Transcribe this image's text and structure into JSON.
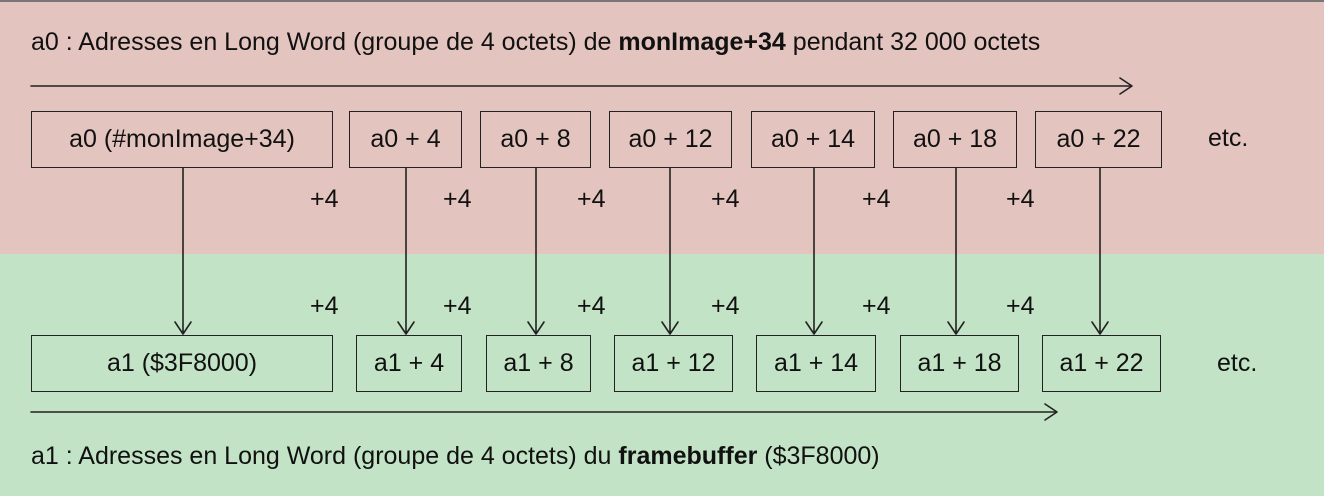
{
  "top": {
    "title_prefix": "a0 : Adresses en Long Word  (groupe de 4 octets)  de ",
    "title_bold": "monImage+34",
    "title_suffix": " pendant 32 000 octets",
    "boxes": [
      "a0 (#monImage+34)",
      "a0 + 4",
      "a0 + 8",
      "a0 + 12",
      "a0 + 14",
      "a0 + 18",
      "a0 + 22"
    ],
    "etc": "etc.",
    "increments": [
      "+4",
      "+4",
      "+4",
      "+4",
      "+4",
      "+4"
    ]
  },
  "bottom": {
    "increments": [
      "+4",
      "+4",
      "+4",
      "+4",
      "+4",
      "+4"
    ],
    "boxes": [
      "a1 ($3F8000)",
      "a1 + 4",
      "a1 + 8",
      "a1 + 12",
      "a1 + 14",
      "a1 + 18",
      "a1 + 22"
    ],
    "etc": "etc.",
    "title_prefix": "a1 : Adresses en Long Word (groupe de 4 octets) du ",
    "title_bold": "framebuffer",
    "title_suffix": " ($3F8000)"
  },
  "colors": {
    "top_band": "#e3c4bf",
    "bottom_band": "#c2e3c5",
    "stroke": "#222222"
  }
}
